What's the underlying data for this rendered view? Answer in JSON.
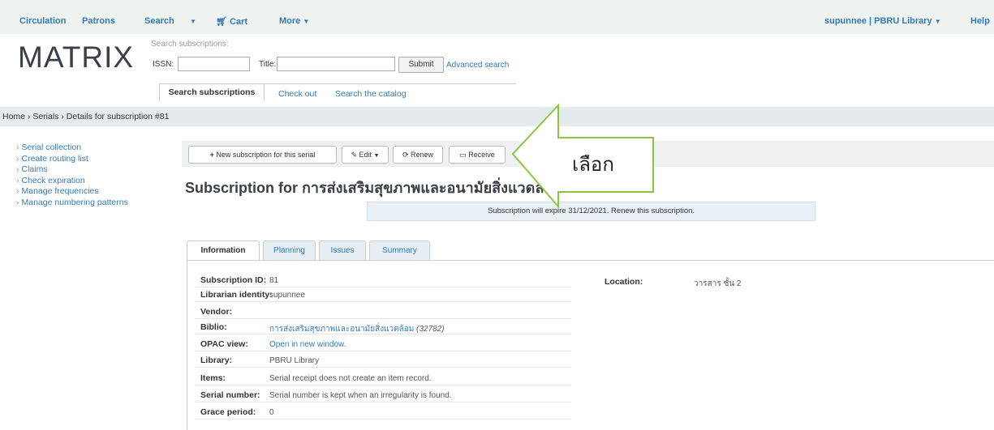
{
  "topnav": {
    "circulation": "Circulation",
    "patrons": "Patrons",
    "search": "Search",
    "cart": "Cart",
    "more": "More",
    "user": "supunnee | PBRU Library",
    "help": "Help"
  },
  "header": {
    "logo": "MATRIX",
    "search_title": "Search subscriptions:",
    "issn_label": "ISSN:",
    "title_label": "Title:",
    "submit": "Submit",
    "advanced": "Advanced search",
    "tabs": [
      "Search subscriptions",
      "Check out",
      "Search the catalog"
    ]
  },
  "breadcrumb": "Home › Serials › Details for subscription #81",
  "sidebar": [
    "Serial collection",
    "Create routing list",
    "Claims",
    "Check expiration",
    "Manage frequencies",
    "Manage numbering patterns"
  ],
  "toolbar": {
    "new": "New subscription for this serial",
    "edit": "Edit",
    "renew": "Renew",
    "receive": "Receive"
  },
  "callout": "เลือก",
  "title": "Subscription for การส่งเสริมสุขภาพและอนามัยสิ่งแวดล้อม",
  "notice": "Subscription will expire 31/12/2021. Renew this subscription.",
  "tabs": [
    "Information",
    "Planning",
    "Issues",
    "Summary"
  ],
  "details": [
    {
      "label": "Subscription ID:",
      "value": "81"
    },
    {
      "label": "Librarian identity:",
      "value": "supunnee"
    },
    {
      "label": "Vendor:",
      "value": ""
    },
    {
      "label": "Biblio:",
      "value": "การส่งเสริมสุขภาพและอนามัยสิ่งแวดล้อม",
      "extra": "(32782)"
    },
    {
      "label": "OPAC view:",
      "value": "Open in new window."
    },
    {
      "label": "Library:",
      "value": "PBRU Library"
    },
    {
      "label": "Items:",
      "value": "Serial receipt does not create an item record."
    },
    {
      "label": "Serial number:",
      "value": "Serial number is kept when an irregularity is found."
    },
    {
      "label": "Grace period:",
      "value": "0"
    }
  ],
  "location": {
    "label": "Location:",
    "value": "วารสาร ชั้น 2"
  },
  "colors": {
    "link": "#337ab7",
    "nav_bg": "#eef3f0",
    "arrow": "#8cc63f"
  }
}
